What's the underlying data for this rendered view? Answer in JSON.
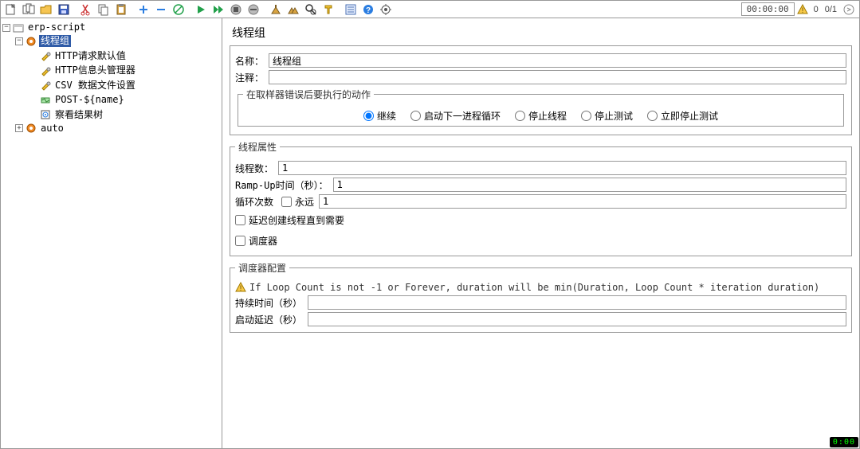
{
  "toolbar": {
    "time": "00:00:00",
    "warn_count": "0",
    "run_count": "0/1"
  },
  "tree": {
    "root": "erp-script",
    "selected": "线程组",
    "children": [
      "HTTP请求默认值",
      "HTTP信息头管理器",
      "CSV 数据文件设置",
      "POST-${name}",
      "察看结果树"
    ],
    "sibling": "auto"
  },
  "panel": {
    "title": "线程组",
    "name_label": "名称：",
    "name_value": "线程组",
    "comment_label": "注释：",
    "comment_value": "",
    "error_action_label": "在取样器错误后要执行的动作",
    "radios": [
      "继续",
      "启动下一进程循环",
      "停止线程",
      "停止测试",
      "立即停止测试"
    ],
    "radio_selected": "继续",
    "thread_props_label": "线程属性",
    "threads_label": "线程数：",
    "threads_value": "1",
    "rampup_label": "Ramp-Up时间（秒）：",
    "rampup_value": "1",
    "loop_label": "循环次数",
    "forever_label": "永远",
    "loop_value": "1",
    "delay_create_label": "延迟创建线程直到需要",
    "scheduler_label": "调度器",
    "sched_config_label": "调度器配置",
    "sched_note": "If Loop Count is not -1 or Forever, duration will be min(Duration, Loop Count * iteration duration)",
    "duration_label": "持续时间（秒）",
    "duration_value": "",
    "startup_delay_label": "启动延迟（秒）",
    "startup_delay_value": ""
  },
  "footer": {
    "clock": "0:00"
  }
}
